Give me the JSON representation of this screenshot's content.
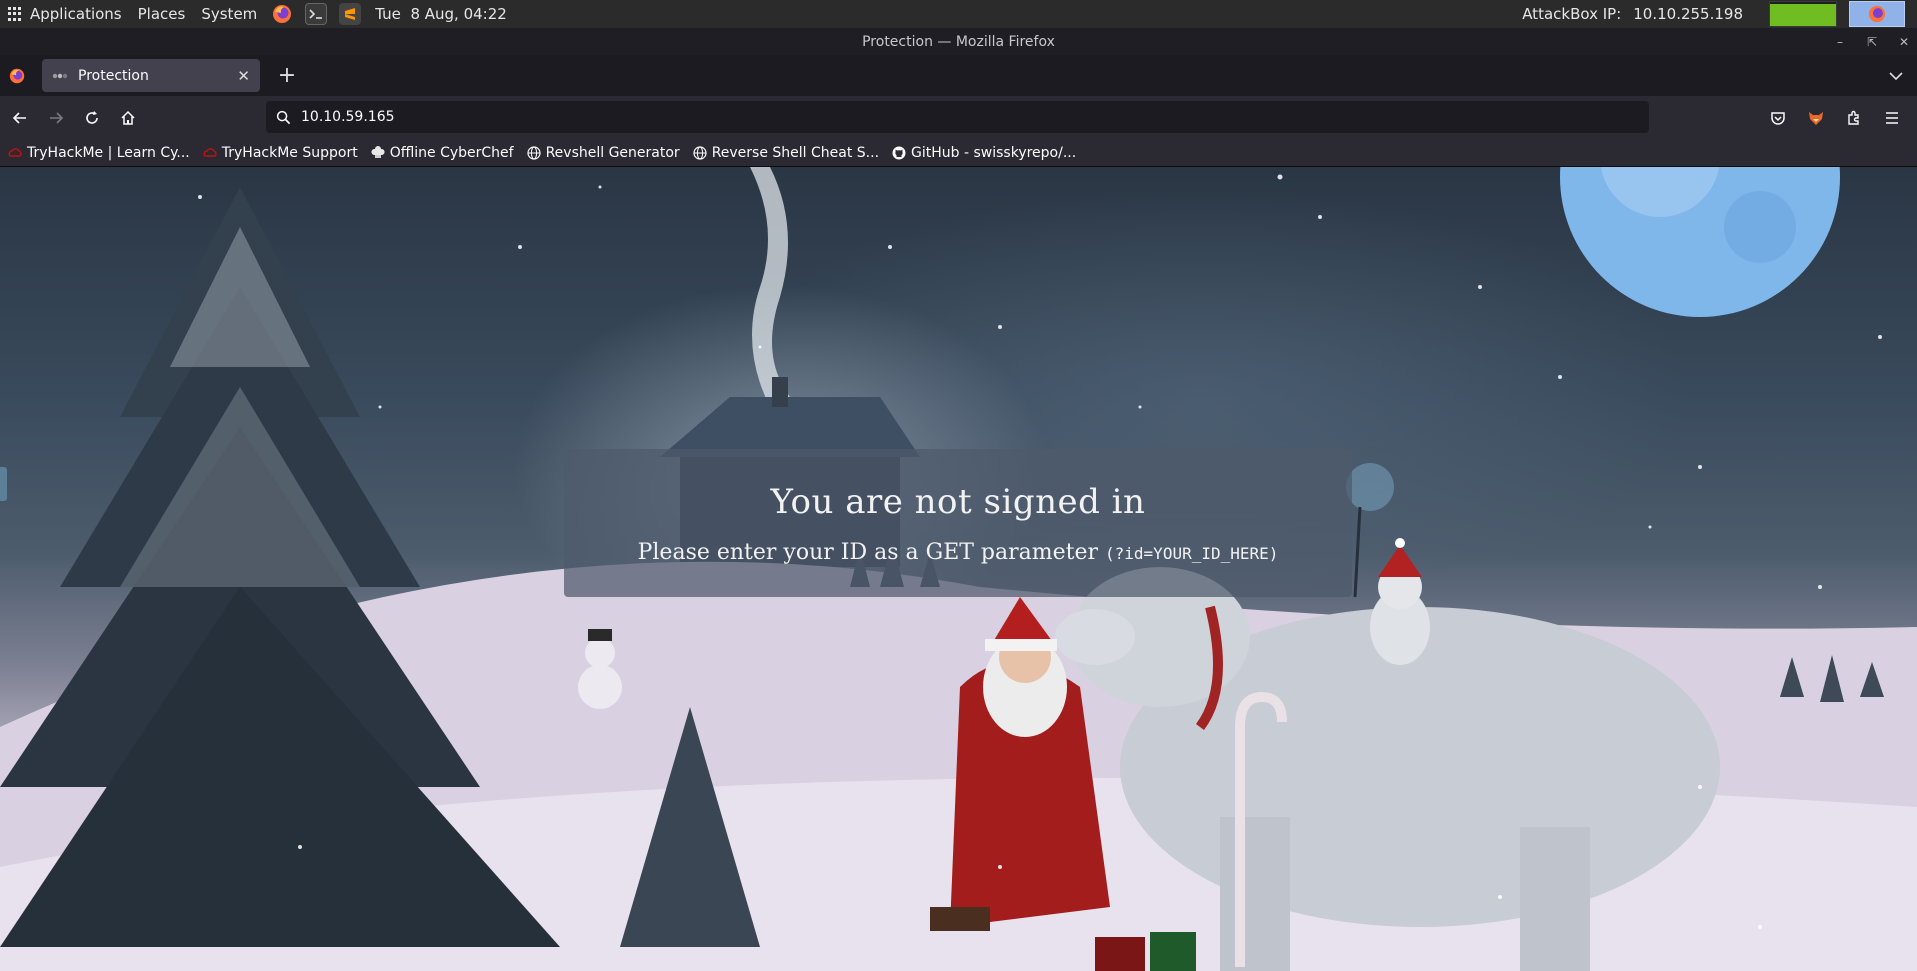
{
  "system_panel": {
    "menus": [
      "Applications",
      "Places",
      "System"
    ],
    "datetime": "Tue  8 Aug, 04:22",
    "attackbox_label": "AttackBox IP:",
    "attackbox_ip": "10.10.255.198",
    "cpu_load": 0.92
  },
  "window": {
    "title": "Protection — Mozilla Firefox"
  },
  "tabs": [
    {
      "title": "Protection",
      "active": true
    }
  ],
  "navbar": {
    "url": "10.10.59.165"
  },
  "bookmarks": [
    {
      "label": "TryHackMe | Learn Cy...",
      "icon": "tryhackme-icon"
    },
    {
      "label": "TryHackMe Support",
      "icon": "tryhackme-icon"
    },
    {
      "label": "Offline CyberChef",
      "icon": "chef-hat-icon"
    },
    {
      "label": "Revshell Generator",
      "icon": "globe-icon"
    },
    {
      "label": "Reverse Shell Cheat S...",
      "icon": "globe-icon"
    },
    {
      "label": "GitHub - swisskyrepo/...",
      "icon": "github-icon"
    }
  ],
  "page": {
    "heading": "You are not signed in",
    "instruction": "Please enter your ID as a GET parameter",
    "instruction_code": "(?id=YOUR_ID_HERE)"
  },
  "colors": {
    "firefox_accent": "#ff7139",
    "tryhackme_red": "#c11111",
    "cpu_green": "#6fbd21"
  }
}
